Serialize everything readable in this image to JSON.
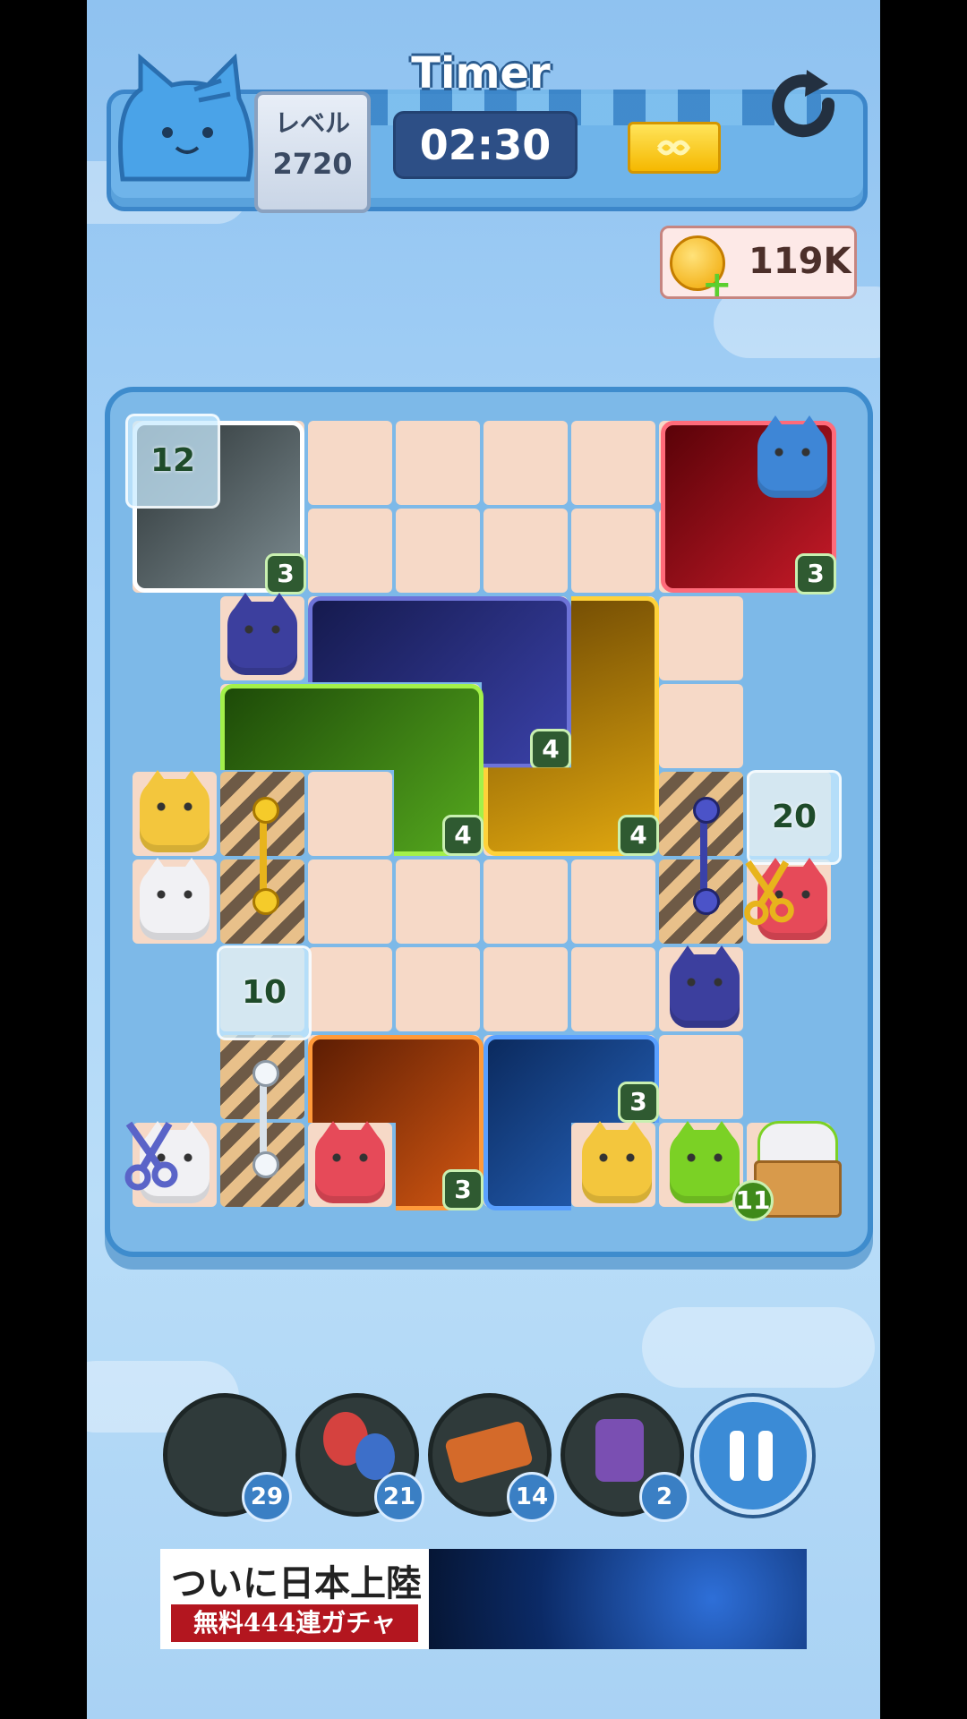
{
  "header": {
    "title": "Timer",
    "level_label": "レベル",
    "level_number": "2720",
    "timer": "02:30"
  },
  "currency": {
    "coins": "119K"
  },
  "board": {
    "block_counts": {
      "gray": "3",
      "red": "3",
      "navy": "4",
      "green": "4",
      "gold": "4",
      "orange": "3",
      "blue": "3"
    },
    "ice_counts": {
      "top_left": "12",
      "right": "20",
      "left_mid": "10"
    },
    "box_count": "11"
  },
  "boosters": [
    {
      "name": "shuffle-booster",
      "count": "29"
    },
    {
      "name": "balloon-booster",
      "count": "21"
    },
    {
      "name": "freeze-booster",
      "count": "14"
    },
    {
      "name": "vacuum-booster",
      "count": "2"
    }
  ],
  "ad": {
    "line1": "ついに日本上陸",
    "line2": "無料444連ガチャ"
  },
  "colors": {
    "gray": "#4e5a5e",
    "red": "#a8101c",
    "navy": "#2a2f7a",
    "green": "#3f8a1a",
    "gold": "#c78a06",
    "orange": "#b7470a",
    "blue": "#1c4f9a"
  }
}
